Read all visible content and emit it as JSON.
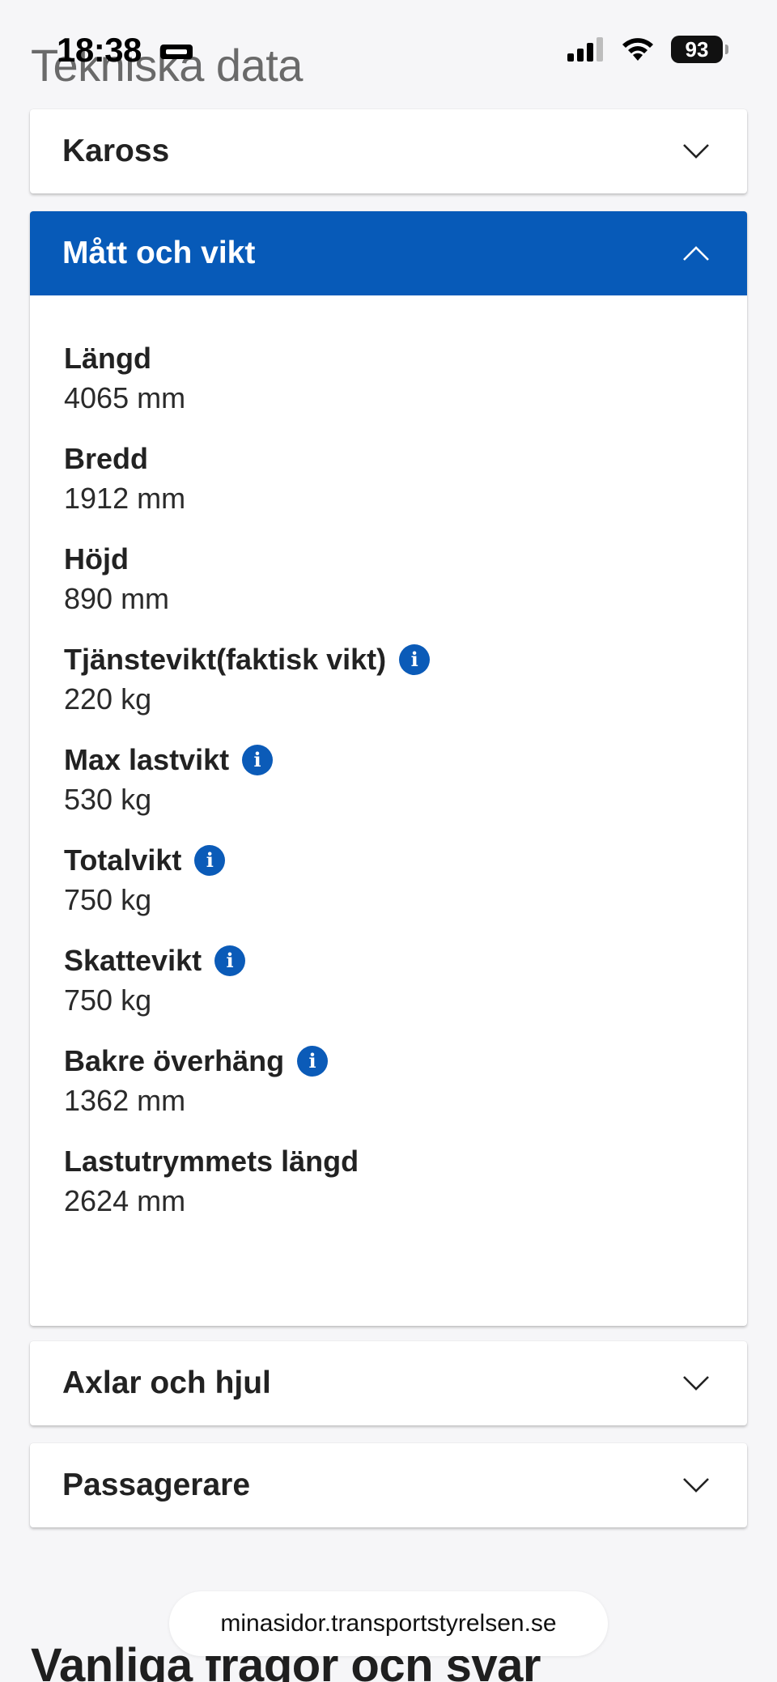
{
  "status_bar": {
    "time": "18:38",
    "battery": "93"
  },
  "section_title": "Tekniska data",
  "accordions": {
    "kaross": {
      "title": "Kaross",
      "expanded": false
    },
    "matt": {
      "title": "Mått och vikt",
      "expanded": true,
      "fields": [
        {
          "label": "Längd",
          "value": "4065 mm",
          "info": false
        },
        {
          "label": "Bredd",
          "value": "1912 mm",
          "info": false
        },
        {
          "label": "Höjd",
          "value": "890 mm",
          "info": false
        },
        {
          "label": "Tjänstevikt(faktisk vikt)",
          "value": "220 kg",
          "info": true
        },
        {
          "label": "Max lastvikt",
          "value": "530 kg",
          "info": true
        },
        {
          "label": "Totalvikt",
          "value": "750 kg",
          "info": true
        },
        {
          "label": "Skattevikt",
          "value": "750 kg",
          "info": true
        },
        {
          "label": "Bakre överhäng",
          "value": "1362 mm",
          "info": true
        },
        {
          "label": "Lastutrymmets längd",
          "value": "2624 mm",
          "info": false
        }
      ]
    },
    "axlar": {
      "title": "Axlar och hjul",
      "expanded": false
    },
    "passagerare": {
      "title": "Passagerare",
      "expanded": false
    }
  },
  "url_bar": {
    "url": "minasidor.transportstyrelsen.se"
  },
  "faq_title": "Vanliga frågor och svar",
  "colors": {
    "accent": "#075ab8",
    "background": "#f6f6f8"
  },
  "icons": [
    "chevron-down-icon",
    "chevron-up-icon",
    "info-icon",
    "signal-icon",
    "wifi-icon",
    "battery-icon",
    "do-not-disturb-icon"
  ]
}
